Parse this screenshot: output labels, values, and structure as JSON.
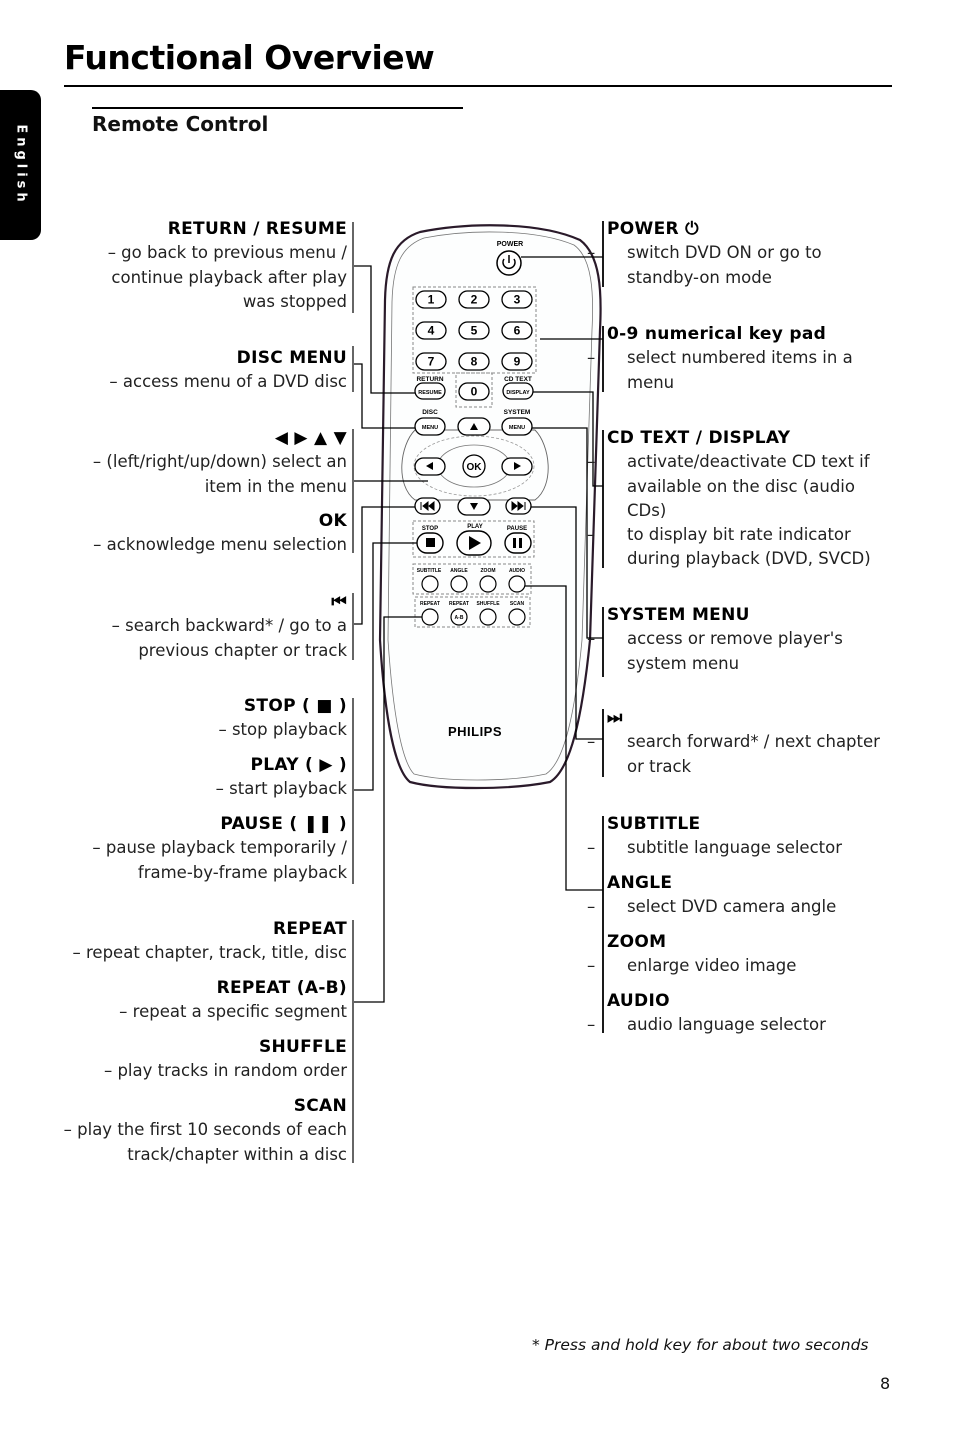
{
  "header": {
    "title": "Functional Overview",
    "section": "Remote Control",
    "language_tab": "English"
  },
  "remote": {
    "brand": "PHILIPS",
    "power_label": "POWER",
    "number_keys": [
      "1",
      "2",
      "3",
      "4",
      "5",
      "6",
      "7",
      "8",
      "9",
      "0"
    ],
    "return_label": "RETURN",
    "resume_label": "RESUME",
    "cdtext_label": "CD TEXT",
    "display_label": "DISPLAY",
    "disc_label": "DISC",
    "system_label": "SYSTEM",
    "menu_label": "MENU",
    "ok_label": "OK",
    "stop_label": "STOP",
    "play_label": "PLAY",
    "pause_label": "PAUSE",
    "subtitle_label": "SUBTITLE",
    "angle_label": "ANGLE",
    "zoom_label": "ZOOM",
    "audio_label": "AUDIO",
    "repeat_label": "REPEAT",
    "repeat_ab_label": "REPEAT",
    "ab_label": "A-B",
    "shuffle_label": "SHUFFLE",
    "scan_label": "SCAN"
  },
  "left": {
    "return_resume": {
      "head": "RETURN / RESUME",
      "lines": [
        "– go back to previous menu /",
        "continue playback after play",
        "was stopped"
      ]
    },
    "disc_menu": {
      "head": "DISC MENU",
      "lines": [
        "– access menu of a DVD disc"
      ]
    },
    "arrows": {
      "head": "◀ ▶ ▲ ▼",
      "lines": [
        "– (left/right/up/down) select an",
        "item in the menu"
      ]
    },
    "ok": {
      "head": "OK",
      "lines": [
        "– acknowledge menu selection"
      ]
    },
    "prev": {
      "head": "⏮",
      "lines": [
        "– search backward* / go to a",
        "previous chapter or track"
      ]
    },
    "stop": {
      "head": "STOP ( ■ )",
      "lines": [
        "– stop playback"
      ]
    },
    "play": {
      "head": "PLAY ( ▶ )",
      "lines": [
        "– start playback"
      ]
    },
    "pause": {
      "head": "PAUSE ( ❚❚ )",
      "lines": [
        "– pause playback temporarily /",
        "frame-by-frame playback"
      ]
    },
    "repeat": {
      "head": "REPEAT",
      "lines": [
        "– repeat chapter, track, title, disc"
      ]
    },
    "repeat_ab": {
      "head": "REPEAT (A-B)",
      "lines": [
        "– repeat a specific segment"
      ]
    },
    "shuffle": {
      "head": "SHUFFLE",
      "lines": [
        "– play tracks in random order"
      ]
    },
    "scan": {
      "head": "SCAN",
      "lines": [
        "– play the first 10 seconds of each",
        "track/chapter within a disc"
      ]
    }
  },
  "right": {
    "power": {
      "head": "POWER",
      "icon": "⏻",
      "lines": [
        "switch DVD ON or go to standby-on mode"
      ]
    },
    "keypad": {
      "head": "0-9 numerical key pad",
      "lines": [
        "select numbered items in a menu"
      ]
    },
    "cd_text": {
      "head": "CD TEXT / DISPLAY",
      "lines": [
        "activate/deactivate CD text if available on the disc (audio CDs)",
        "to display bit rate indicator during playback (DVD, SVCD)"
      ]
    },
    "system_menu": {
      "head": "SYSTEM MENU",
      "lines": [
        "access or remove player's system menu"
      ]
    },
    "next": {
      "head": "⏭",
      "lines": [
        "search forward* / next chapter or track"
      ]
    },
    "subtitle": {
      "head": "SUBTITLE",
      "lines": [
        "subtitle language selector"
      ]
    },
    "angle": {
      "head": "ANGLE",
      "lines": [
        "select DVD camera angle"
      ]
    },
    "zoom": {
      "head": "ZOOM",
      "lines": [
        "enlarge video image"
      ]
    },
    "audio": {
      "head": "AUDIO",
      "lines": [
        "audio language selector"
      ]
    }
  },
  "dash": "–",
  "footer": {
    "footnote": "* Press and hold key for about two seconds",
    "page_number": "8"
  }
}
